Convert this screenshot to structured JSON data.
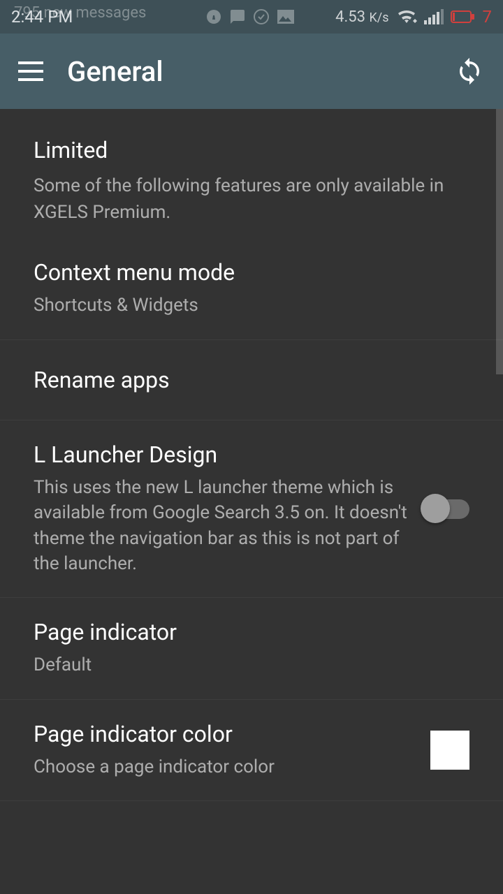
{
  "status_bar": {
    "time": "2:44 PM",
    "overlay_text": "795 new messages",
    "data_rate": "4.53",
    "data_rate_unit": "K/s",
    "battery_percent": "7"
  },
  "toolbar": {
    "title": "General"
  },
  "header": {
    "title": "Limited",
    "subtitle": "Some of the following features are only available in XGELS Premium."
  },
  "items": [
    {
      "title": "Context menu mode",
      "subtitle": "Shortcuts & Widgets"
    },
    {
      "title": "Rename apps",
      "subtitle": ""
    },
    {
      "title": "L Launcher Design",
      "subtitle": "This uses the new L launcher theme which is available from Google Search 3.5 on. It doesn't theme the navigation bar as this is not part of the launcher."
    },
    {
      "title": "Page indicator",
      "subtitle": "Default"
    },
    {
      "title": "Page indicator color",
      "subtitle": "Choose a page indicator color"
    }
  ],
  "colors": {
    "swatch": "#ffffff"
  }
}
